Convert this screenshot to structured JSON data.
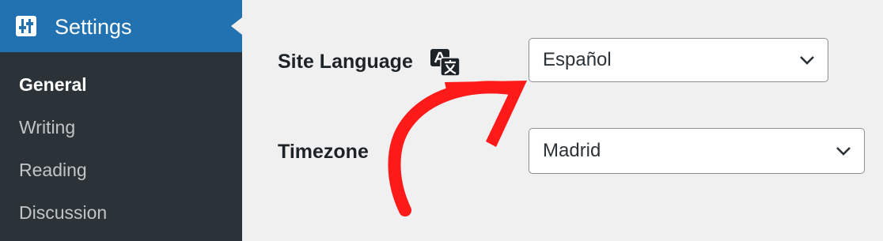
{
  "sidebar": {
    "menu_title": "Settings",
    "menu_icon": "settings-sliders-icon",
    "items": [
      {
        "label": "General",
        "current": true
      },
      {
        "label": "Writing"
      },
      {
        "label": "Reading"
      },
      {
        "label": "Discussion"
      }
    ]
  },
  "form": {
    "site_language": {
      "label": "Site Language",
      "icon": "translate-icon",
      "value": "Español"
    },
    "timezone": {
      "label": "Timezone",
      "value": "Madrid"
    }
  },
  "colors": {
    "sidebar_bg": "#2c3338",
    "menu_active_bg": "#2271b1",
    "content_bg": "#f0f0f1",
    "annotation_arrow": "#ff1a1a"
  }
}
